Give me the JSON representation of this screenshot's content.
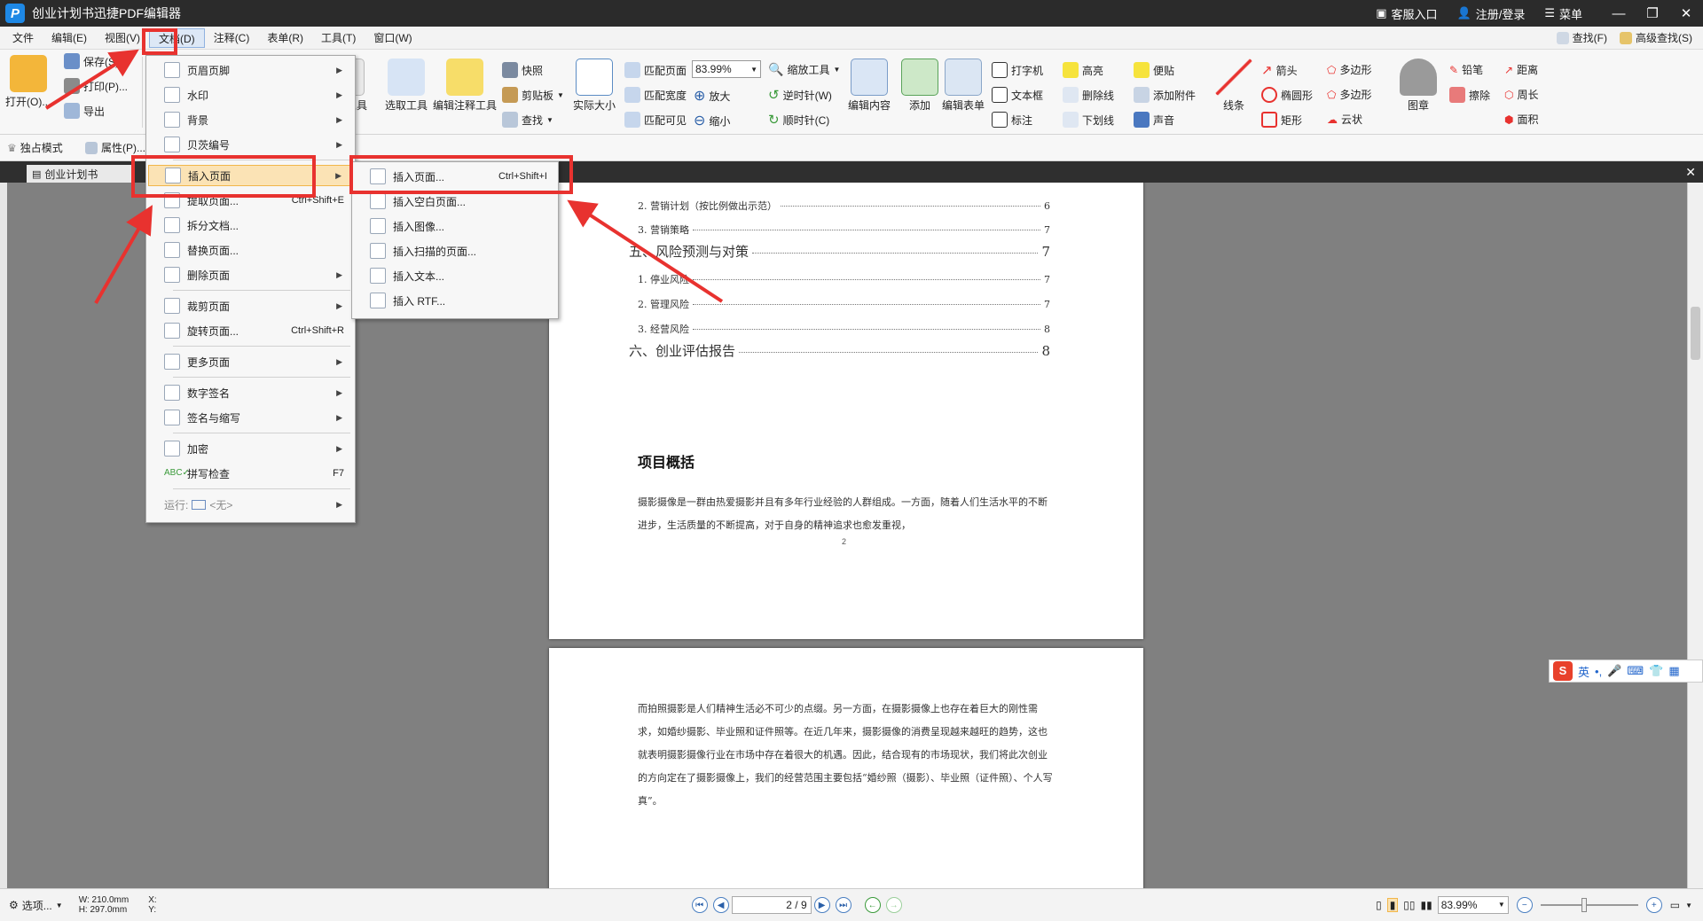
{
  "window": {
    "title": "创业计划书迅捷PDF编辑器",
    "support": "客服入口",
    "register": "注册/登录",
    "menu": "菜单"
  },
  "menubar": {
    "items": [
      "文件",
      "编辑(E)",
      "视图(V)",
      "文档(D)",
      "注释(C)",
      "表单(R)",
      "工具(T)",
      "窗口(W)"
    ],
    "find": "查找(F)",
    "advanced_find": "高级查找(S)"
  },
  "ribbon": {
    "open": "打开(O)...",
    "save": "保存(S)",
    "print": "打印(P)...",
    "export": "导出",
    "hand_tool": "手形工具",
    "select_tool": "选取工具",
    "edit_annot_tool": "编辑注释工具",
    "snapshot": "快照",
    "clipboard": "剪贴板",
    "find": "查找",
    "actual_size": "实际大小",
    "fit_page": "匹配页面",
    "fit_width": "匹配宽度",
    "fit_visible": "匹配可见",
    "zoom_value": "83.99%",
    "zoom_in": "放大",
    "zoom_out": "缩小",
    "zoom_tool": "缩放工具",
    "rotate_ccw": "逆时针(W)",
    "rotate_cw": "顺时针(C)",
    "edit_content": "编辑内容",
    "add": "添加",
    "edit_form": "编辑表单",
    "typewriter": "打字机",
    "textbox": "文本框",
    "callout": "标注",
    "highlight": "高亮",
    "strikeout": "删除线",
    "underline": "下划线",
    "note": "便贴",
    "attach": "添加附件",
    "sound": "声音",
    "line": "线条",
    "arrow": "箭头",
    "ellipse": "椭圆形",
    "rectangle": "矩形",
    "polygon": "多边形",
    "polyline": "多边形",
    "cloud": "云状",
    "stamp": "图章",
    "pencil": "铅笔",
    "eraser": "擦除",
    "distance": "距离",
    "perimeter": "周长",
    "area": "面积",
    "exclusive_mode": "独占模式",
    "properties": "属性(P)..."
  },
  "tab": {
    "label": "创业计划书"
  },
  "doc_menu": {
    "items": [
      {
        "label": "页眉页脚",
        "shortcut": "",
        "sub": true
      },
      {
        "label": "水印",
        "shortcut": "",
        "sub": true
      },
      {
        "label": "背景",
        "shortcut": "",
        "sub": true
      },
      {
        "label": "贝茨编号",
        "shortcut": "",
        "sub": true
      },
      {
        "label": "插入页面",
        "shortcut": "",
        "sub": true
      },
      {
        "label": "提取页面...",
        "shortcut": "Ctrl+Shift+E",
        "sub": false
      },
      {
        "label": "拆分文档...",
        "shortcut": "",
        "sub": false
      },
      {
        "label": "替换页面...",
        "shortcut": "",
        "sub": false
      },
      {
        "label": "删除页面",
        "shortcut": "",
        "sub": true
      },
      {
        "label": "裁剪页面",
        "shortcut": "",
        "sub": true
      },
      {
        "label": "旋转页面...",
        "shortcut": "Ctrl+Shift+R",
        "sub": false
      },
      {
        "label": "更多页面",
        "shortcut": "",
        "sub": true
      },
      {
        "label": "数字签名",
        "shortcut": "",
        "sub": true
      },
      {
        "label": "签名与缩写",
        "shortcut": "",
        "sub": true
      },
      {
        "label": "加密",
        "shortcut": "",
        "sub": true
      },
      {
        "label": "拼写检查",
        "shortcut": "F7",
        "sub": false
      }
    ],
    "run_label": "运行:",
    "run_value": "<无>"
  },
  "insert_submenu": {
    "items": [
      {
        "label": "插入页面...",
        "shortcut": "Ctrl+Shift+I"
      },
      {
        "label": "插入空白页面...",
        "shortcut": ""
      },
      {
        "label": "插入图像...",
        "shortcut": ""
      },
      {
        "label": "插入扫描的页面...",
        "shortcut": ""
      },
      {
        "label": "插入文本...",
        "shortcut": ""
      },
      {
        "label": "插入 RTF...",
        "shortcut": ""
      }
    ]
  },
  "document": {
    "toc": [
      {
        "text": "2. 营销计划（按比例做出示范）",
        "page": "6",
        "size": "sm"
      },
      {
        "text": "3. 营销策略",
        "page": "7",
        "size": "sm"
      },
      {
        "text": "五、风险预测与对策",
        "page": "7",
        "size": "lg"
      },
      {
        "text": "1. 停业风险",
        "page": "7",
        "size": "sm"
      },
      {
        "text": "2. 管理风险",
        "page": "7",
        "size": "sm"
      },
      {
        "text": "3. 经营风险",
        "page": "8",
        "size": "sm"
      },
      {
        "text": "六、创业评估报告",
        "page": "8",
        "size": "lg"
      }
    ],
    "heading": "项目概括",
    "para1": "摄影摄像是一群由热爱摄影并且有多年行业经验的人群组成。一方面，随着人们生活水平的不断进步，生活质量的不断提高，对于自身的精神追求也愈发重视，",
    "page_number": "2",
    "para2": "而拍照摄影是人们精神生活必不可少的点缀。另一方面，在摄影摄像上也存在着巨大的刚性需求，如婚纱摄影、毕业照和证件照等。在近几年来，摄影摄像的消费呈现越来越旺的趋势，这也就表明摄影摄像行业在市场中存在着很大的机遇。因此，结合现有的市场现状，我们将此次创业的方向定在了摄影摄像上，我们的经营范围主要包括“婚纱照（摄影）、毕业照（证件照）、个人写真”。"
  },
  "statusbar": {
    "select": "选项...",
    "width": "W: 210.0mm",
    "height": "H: 297.0mm",
    "x": "X:",
    "y": "Y:",
    "page": "2 / 9",
    "zoom": "83.99%"
  },
  "ime": {
    "lang": "英"
  },
  "colors": {
    "accent_red": "#e8322f",
    "highlight": "#fbe3b5",
    "titlebar": "#2b2b2b"
  }
}
